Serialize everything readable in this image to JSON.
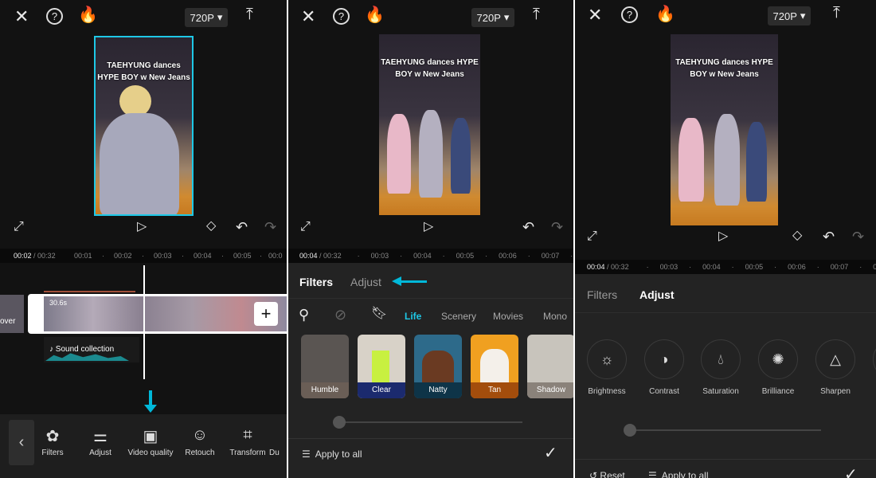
{
  "common": {
    "resolution": "720P",
    "video_title": "TAEHYUNG dances HYPE BOY w New Jeans"
  },
  "panel1": {
    "timecode_current": "00:02",
    "timecode_total": "/ 00:32",
    "ticks": [
      "00:01",
      "00:02",
      "00:03",
      "00:04",
      "00:05",
      "00:0"
    ],
    "clip_duration": "30.6s",
    "cover_label": "over",
    "sound_label": "Sound collection",
    "tools": [
      {
        "label": "Filters",
        "icon": "filters-icon"
      },
      {
        "label": "Adjust",
        "icon": "adjust-icon"
      },
      {
        "label": "Video quality",
        "icon": "video-quality-hd-icon"
      },
      {
        "label": "Retouch",
        "icon": "retouch-icon"
      },
      {
        "label": "Transform",
        "icon": "crop-icon"
      },
      {
        "label": "Du",
        "icon": "duplicate-icon"
      }
    ]
  },
  "panel2": {
    "timecode_current": "00:04",
    "timecode_total": "/ 00:32",
    "ticks": [
      "00:03",
      "00:04",
      "00:05",
      "00:06",
      "00:07",
      "0"
    ],
    "tabs": [
      "Filters",
      "Adjust"
    ],
    "categories": [
      "Life",
      "Scenery",
      "Movies",
      "Mono"
    ],
    "filters": [
      {
        "label": "Humble",
        "color": "#6a5e56"
      },
      {
        "label": "Clear",
        "color": "#1b2a6e"
      },
      {
        "label": "Natty",
        "color": "#0e3448"
      },
      {
        "label": "Tan",
        "color": "#a34d0c"
      },
      {
        "label": "Shadow",
        "color": "#8a827a"
      }
    ],
    "apply_all": "Apply to all"
  },
  "panel3": {
    "timecode_current": "00:04",
    "timecode_total": "/ 00:32",
    "ticks": [
      "00:03",
      "00:04",
      "00:05",
      "00:06",
      "00:07",
      "0"
    ],
    "tabs": [
      "Filters",
      "Adjust"
    ],
    "adjust_items": [
      {
        "label": "Brightness",
        "icon": "brightness-icon"
      },
      {
        "label": "Contrast",
        "icon": "contrast-icon"
      },
      {
        "label": "Saturation",
        "icon": "saturation-drop-icon"
      },
      {
        "label": "Brilliance",
        "icon": "brilliance-icon"
      },
      {
        "label": "Sharpen",
        "icon": "sharpen-triangle-icon"
      }
    ],
    "reset": "Reset",
    "apply_all": "Apply to all"
  },
  "colors": {
    "accent": "#1ec8e6",
    "annotation_arrow": "#00b8d9",
    "bg": "#121212",
    "sheet": "#232323"
  }
}
